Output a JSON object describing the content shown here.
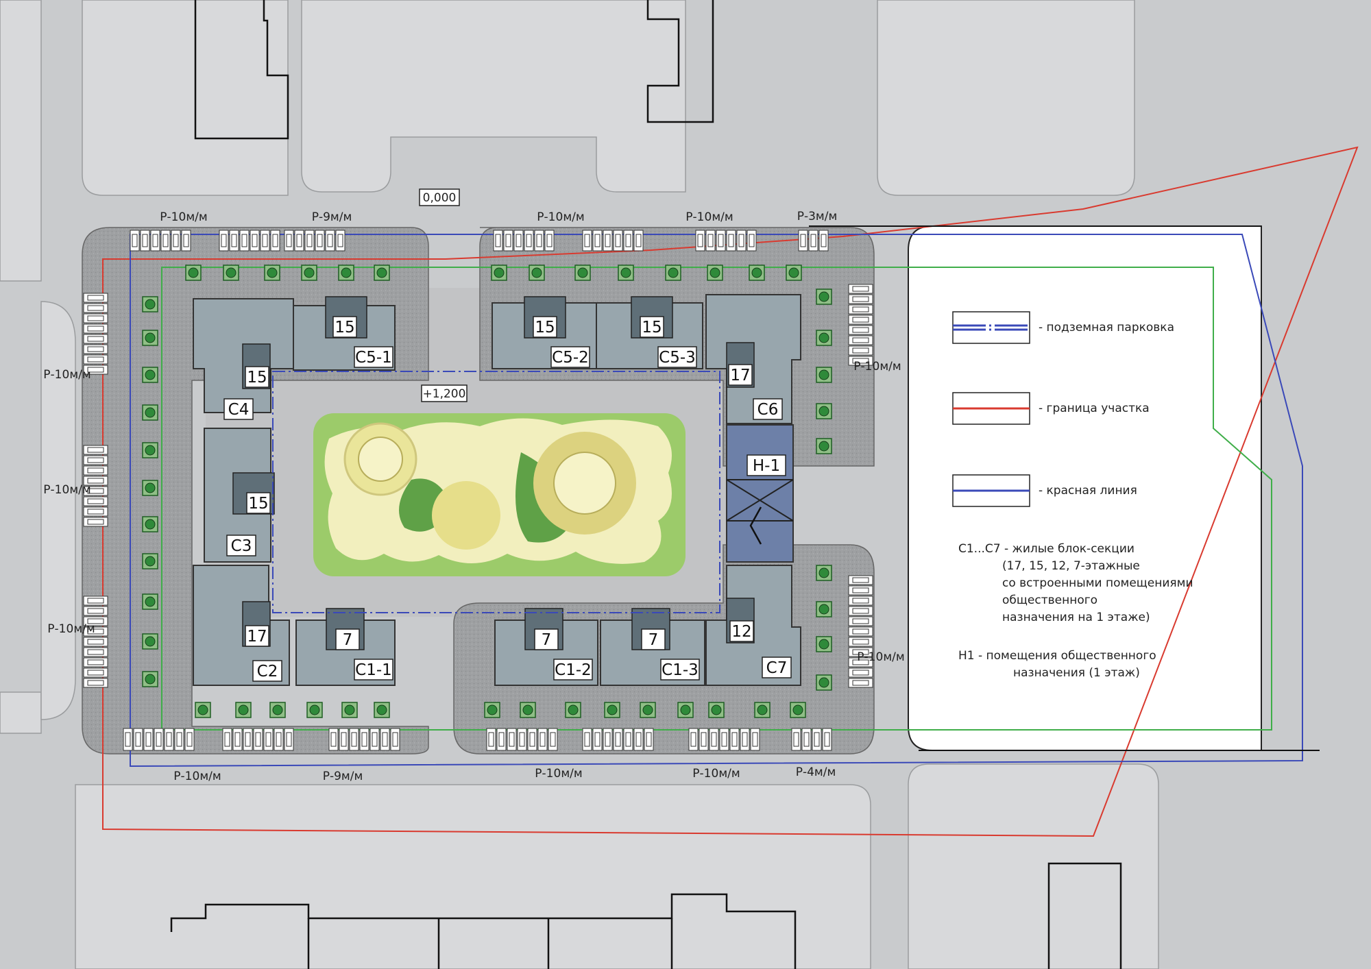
{
  "elevations": {
    "ground": "0,000",
    "courtyard": "+1,200"
  },
  "parking_labels": {
    "top": [
      "Р-10м/м",
      "Р-9м/м",
      "Р-10м/м",
      "Р-10м/м",
      "Р-3м/м"
    ],
    "bottom": [
      "Р-10м/м",
      "Р-9м/м",
      "Р-10м/м",
      "Р-10м/м",
      "Р-4м/м"
    ],
    "left": [
      "Р-10м/м",
      "Р-10м/м",
      "Р-10м/м"
    ],
    "right": [
      "Р-10м/м",
      "Р-10м/м"
    ]
  },
  "buildings": [
    {
      "name": "С4",
      "floors": "15"
    },
    {
      "name": "С5-1",
      "floors": "15"
    },
    {
      "name": "С5-2",
      "floors": "15"
    },
    {
      "name": "С5-3",
      "floors": "15"
    },
    {
      "name": "С6",
      "floors": "17"
    },
    {
      "name": "С3",
      "floors": "15"
    },
    {
      "name": "Н-1",
      "floors": ""
    },
    {
      "name": "С2",
      "floors": "17"
    },
    {
      "name": "С1-1",
      "floors": "7"
    },
    {
      "name": "С1-2",
      "floors": "7"
    },
    {
      "name": "С1-3",
      "floors": "7"
    },
    {
      "name": "С7",
      "floors": "12"
    }
  ],
  "legend": {
    "items": [
      {
        "label": "- подземная парковка",
        "color": "#3a49b8"
      },
      {
        "label": "- граница участка",
        "color": "#d93a2f"
      },
      {
        "label": "- красная линия",
        "color": "#3a49b8"
      }
    ],
    "note1": [
      "С1...С7 - жилые блок-секции",
      "(17, 15, 12, 7-этажные",
      "со встроенными помещениями",
      "общественного",
      "назначения на 1 этаже)"
    ],
    "note2": [
      "Н1     - помещения общественного",
      "назначения (1 этаж)"
    ]
  },
  "colors": {
    "background": "#c9cbcd",
    "street": "#d7d8da",
    "paving": "#9fa1a3",
    "building": "#98a6ad",
    "courtyard_green": "#9cc96a",
    "boundary": "#d93a2f",
    "red_line": "#3a49b8",
    "green_line": "#3fae49"
  }
}
